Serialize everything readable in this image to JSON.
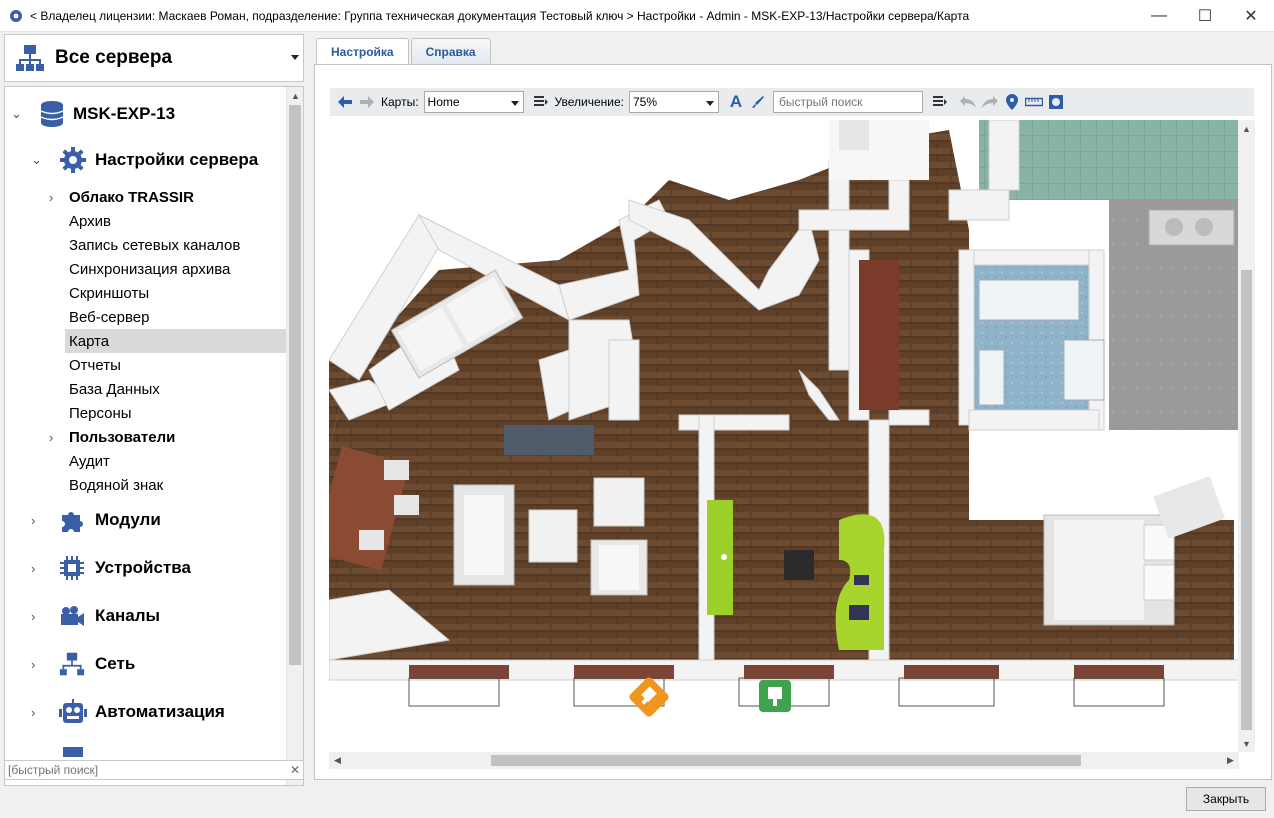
{
  "window": {
    "title": "< Владелец лицензии: Маскаев Роман, подразделение: Группа техническая документация Тестовый ключ > Настройки - Admin - MSK-EXP-13/Настройки сервера/Карта",
    "minimize": "—",
    "maximize": "☐",
    "close": "✕"
  },
  "left": {
    "server_selector": "Все сервера",
    "tree": [
      {
        "label": "MSK-EXP-13",
        "icon": "database-icon"
      },
      {
        "label": "Настройки сервера",
        "icon": "gear-icon"
      },
      {
        "label": "Облако TRASSIR"
      },
      {
        "label": "Архив"
      },
      {
        "label": "Запись сетевых каналов"
      },
      {
        "label": "Синхронизация архива"
      },
      {
        "label": "Скриншоты"
      },
      {
        "label": "Веб-сервер"
      },
      {
        "label": "Карта"
      },
      {
        "label": "Отчеты"
      },
      {
        "label": "База Данных"
      },
      {
        "label": "Персоны"
      },
      {
        "label": "Пользователи"
      },
      {
        "label": "Аудит"
      },
      {
        "label": "Водяной знак"
      },
      {
        "label": "Модули",
        "icon": "puzzle-icon"
      },
      {
        "label": "Устройства",
        "icon": "chip-icon"
      },
      {
        "label": "Каналы",
        "icon": "camera-icon"
      },
      {
        "label": "Сеть",
        "icon": "network-icon"
      },
      {
        "label": "Автоматизация",
        "icon": "robot-icon"
      }
    ],
    "search_placeholder": "[быстрый поиск]",
    "search_clear": "✕"
  },
  "tabs": [
    "Настройка",
    "Справка"
  ],
  "toolbar": {
    "maps_label": "Карты:",
    "maps_value": "Home",
    "zoom_label": "Увеличение:",
    "zoom_value": "75%",
    "search_placeholder": "быстрый поиск"
  },
  "map": {
    "markers": [
      {
        "name": "camera-marker-orange",
        "color": "#f0961e"
      },
      {
        "name": "camera-marker-green",
        "color": "#3fa34d"
      }
    ]
  },
  "footer": {
    "close_button": "Закрыть"
  },
  "colors": {
    "accent": "#2d5da8",
    "floor": "#6b4a2e",
    "wall": "#f4f4f4"
  }
}
